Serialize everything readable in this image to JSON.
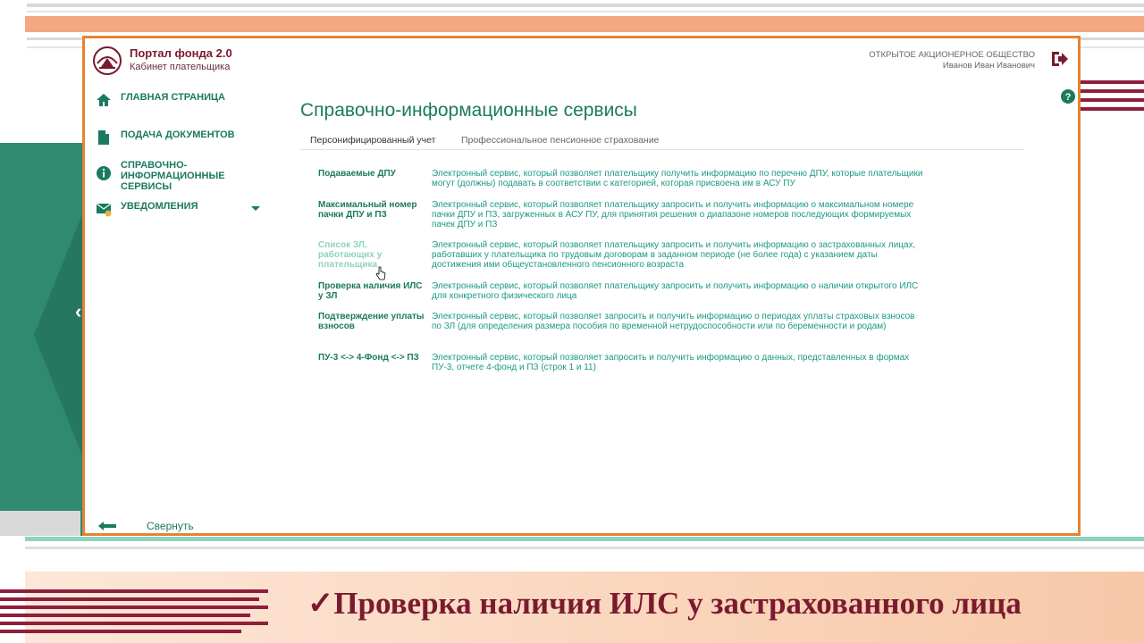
{
  "app": {
    "title": "Портал фонда 2.0",
    "subtitle": "Кабинет плательщика",
    "org": "ОТКРЫТОЕ АКЦИОНЕРНОЕ ОБЩЕСТВО",
    "user": "Иванов Иван Иванович"
  },
  "sidebar": {
    "items": [
      {
        "label": "ГЛАВНАЯ СТРАНИЦА",
        "icon": "home-icon"
      },
      {
        "label": "ПОДАЧА ДОКУМЕНТОВ",
        "icon": "document-icon"
      },
      {
        "label": "СПРАВОЧНО-ИНФОРМАЦИОННЫЕ СЕРВИСЫ",
        "icon": "info-icon"
      },
      {
        "label": "УВЕДОМЛЕНИЯ",
        "icon": "mail-icon"
      }
    ],
    "collapse_label": "Свернуть"
  },
  "main": {
    "title": "Справочно-информационные сервисы",
    "tabs": [
      {
        "label": "Персонифицированный учет"
      },
      {
        "label": "Профессиональное пенсионное страхование"
      }
    ],
    "services": [
      {
        "name": "Подаваемые ДПУ",
        "desc": "Электронный сервис, который позволяет плательщику получить информацию по перечню ДПУ, которые плательщики могут (должны) подавать в соответствии с категорией, которая присвоена им в АСУ ПУ"
      },
      {
        "name": "Максимальный номер пачки ДПУ и ПЗ",
        "desc": "Электронный сервис, который позволяет плательщику запросить и получить информацию о максимальном номере пачки ДПУ и ПЗ, загруженных в АСУ ПУ, для принятия решения о диапазоне номеров последующих формируемых пачек ДПУ и ПЗ"
      },
      {
        "name": "Список ЗЛ, работающих у плательщика",
        "desc": "Электронный сервис, который позволяет плательщику запросить и получить информацию о застрахованных лицах, работавших у плательщика по трудовым договорам в заданном периоде (не более года) с указанием даты достижения ими общеустановленного пенсионного возраста"
      },
      {
        "name": "Проверка наличия ИЛС у ЗЛ",
        "desc": "Электронный сервис, который позволяет плательщику запросить и получить информацию о наличии открытого ИЛС для конкретного физического лица"
      },
      {
        "name": "Подтверждение уплаты взносов",
        "desc": "Электронный сервис, который позволяет запросить и получить информацию о периодах уплаты страховых взносов по ЗЛ (для определения размера пособия по временной нетрудоспособности или по беременности и родам)"
      },
      {
        "name": "ПУ-3 <-> 4-Фонд <-> ПЗ",
        "desc": "Электронный сервис, который позволяет запросить и получить информацию о данных, представленных в формах ПУ-3, отчете 4-фонд и ПЗ (строк 1 и 11)"
      }
    ]
  },
  "caption": "✓Проверка наличия ИЛС у застрахованного лица",
  "colors": {
    "accent": "#1a7a5f",
    "brand": "#7a1a2e",
    "frame": "#e8822f"
  }
}
